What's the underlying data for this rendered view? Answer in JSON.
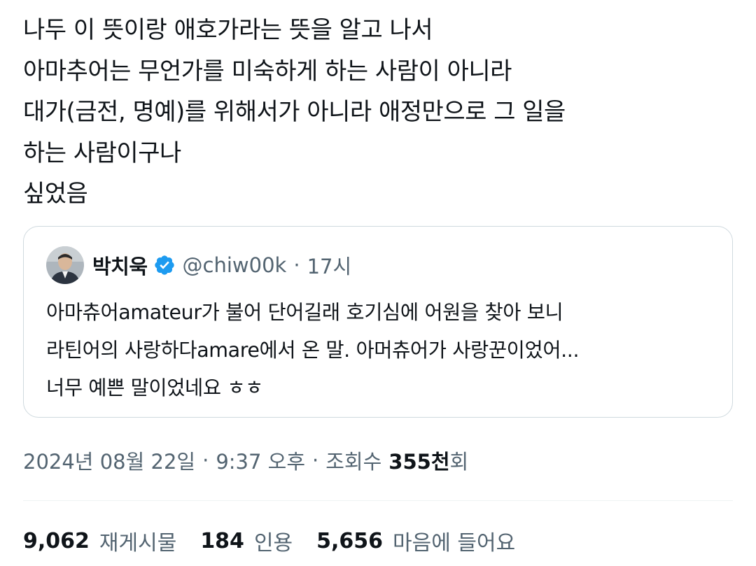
{
  "tweet": {
    "text": "나두 이 뜻이랑 애호가라는 뜻을 알고 나서\n아마추어는 무언가를 미숙하게 하는 사람이 아니라\n대가(금전, 명예)를 위해서가 아니라 애정만으로 그 일을\n하는 사람이구나\n싶었음"
  },
  "quote": {
    "author_name": "박치욱",
    "author_handle": "@chiw00k",
    "separator": "·",
    "time": "17시",
    "verified_icon": "verified-badge-icon",
    "verified_color": "#1d9bf0",
    "text": "아마츄어amateur가 불어 단어길래 호기심에 어원을 찾아 보니\n라틴어의 사랑하다amare에서 온 말. 아머츄어가 사랑꾼이었어...\n너무 예쁜 말이었네요 ㅎㅎ"
  },
  "meta": {
    "date": "2024년 08월 22일",
    "separator1": "·",
    "time": "9:37 오후",
    "separator2": "·",
    "views_label": "조회수",
    "views_count": "355천",
    "views_suffix": "회"
  },
  "stats": {
    "reposts_count": "9,062",
    "reposts_label": "재게시물",
    "quotes_count": "184",
    "quotes_label": "인용",
    "likes_count": "5,656",
    "likes_label": "마음에 들어요"
  },
  "colors": {
    "text_primary": "#0f1419",
    "text_secondary": "#536471",
    "border": "#cfd9de",
    "accent": "#1d9bf0"
  }
}
